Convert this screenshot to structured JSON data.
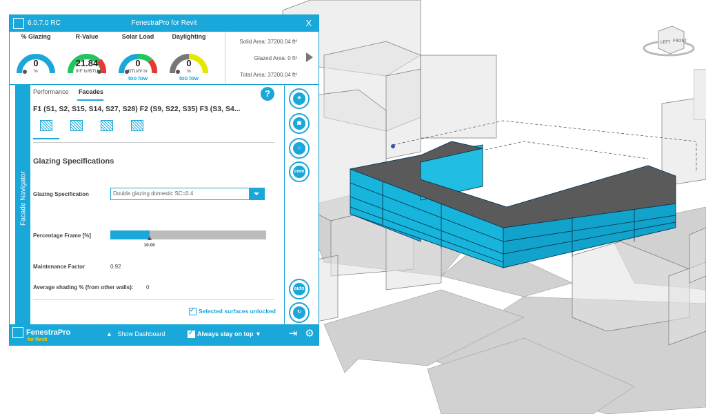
{
  "window": {
    "version": "6.0.7.0  RC",
    "title": "FenestraPro for Revit",
    "close_label": "X"
  },
  "gauges": [
    {
      "label": "% Glazing",
      "value": "0",
      "unit": "%",
      "status": "",
      "fill": 0.0,
      "color": "#1aa7da"
    },
    {
      "label": "R-Value",
      "value": "21.84",
      "unit": "ft²F hr/BTU",
      "status": "",
      "fill": 0.9,
      "color": "#22c55e"
    },
    {
      "label": "Solar Load",
      "value": "0",
      "unit": "BTU/ft² hr",
      "status": "too low",
      "fill": 0.0,
      "color": "#1aa7da"
    },
    {
      "label": "Daylighting",
      "value": "0",
      "unit": "%",
      "status": "too low",
      "fill": 0.0,
      "color": "#e6e600"
    }
  ],
  "areas": {
    "solid": "Solid Area:  37200.04 ft²",
    "glazed": "Glazed Area:  0 ft²",
    "total": "Total Area:  37200.04 ft²"
  },
  "sidebar_label": "Facade Navigator",
  "tabs": {
    "performance": "Performance",
    "facades": "Facades"
  },
  "help_label": "?",
  "facade_list": "F1 (S1, S2, S15, S14, S27, S28) F2 (S9, S22, S35) F3 (S3, S4...",
  "glazing": {
    "section_title": "Glazing Specifications",
    "spec_label": "Glazing Specification",
    "spec_value": "Double glazing domestic SC=0.4",
    "frame_label": "Percentage Frame [%]",
    "frame_value": "10.00",
    "frame_fraction": 0.25,
    "maintenance_label": "Maintenance Factor",
    "maintenance_value": "0.92",
    "shading_label": "Average shading % (from other walls):",
    "shading_value": "0",
    "unlocked_label": "Selected surfaces unlocked"
  },
  "right_buttons": [
    "sun-icon",
    "camera-icon",
    "building-icon",
    "com",
    "auto",
    "refresh-icon"
  ],
  "right_button_text": {
    "com": "com",
    "auto": "auto"
  },
  "bottom": {
    "logo_main": "FenestraPro",
    "logo_sub": "for Revit",
    "show_dashboard": "Show Dashboard",
    "always_on_top": "Always stay on top",
    "dashboard_arrow": "▲",
    "stay_arrow": "▼"
  },
  "viewcube": {
    "left": "LEFT",
    "front": "FRONT"
  },
  "colors": {
    "accent": "#1aa7da",
    "building": "#17b4dc",
    "roof": "#5a5a5a"
  }
}
